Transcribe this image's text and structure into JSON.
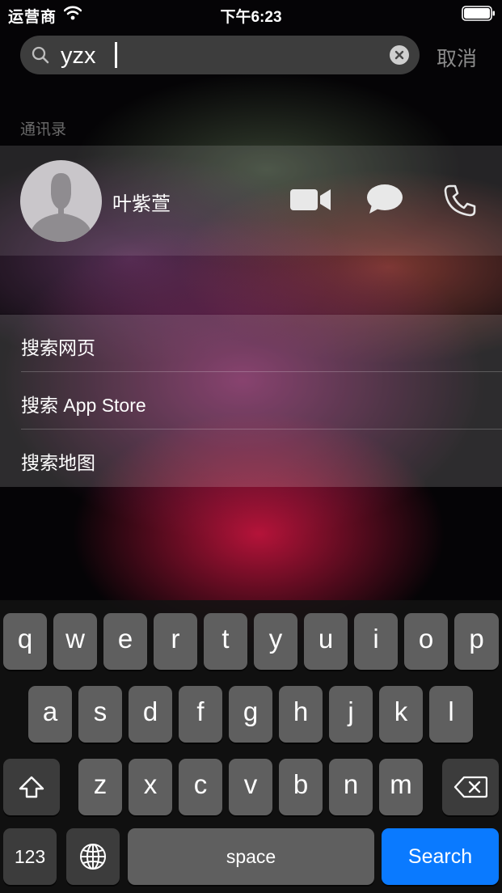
{
  "status_bar": {
    "carrier": "运营商",
    "time": "下午6:23"
  },
  "search": {
    "query": "yzx",
    "cancel_label": "取消"
  },
  "contacts": {
    "section_title": "通讯录",
    "items": [
      {
        "name": "叶紫萱"
      }
    ]
  },
  "suggestions": [
    {
      "label": "搜索网页"
    },
    {
      "label": "搜索 App Store"
    },
    {
      "label": "搜索地图"
    }
  ],
  "keyboard": {
    "row1": [
      "q",
      "w",
      "e",
      "r",
      "t",
      "y",
      "u",
      "i",
      "o",
      "p"
    ],
    "row2": [
      "a",
      "s",
      "d",
      "f",
      "g",
      "h",
      "j",
      "k",
      "l"
    ],
    "row3": [
      "z",
      "x",
      "c",
      "v",
      "b",
      "n",
      "m"
    ],
    "numbers_label": "123",
    "space_label": "space",
    "search_label": "Search"
  },
  "colors": {
    "accent": "#0a7aff",
    "cancel_text": "#8b8b8b"
  }
}
